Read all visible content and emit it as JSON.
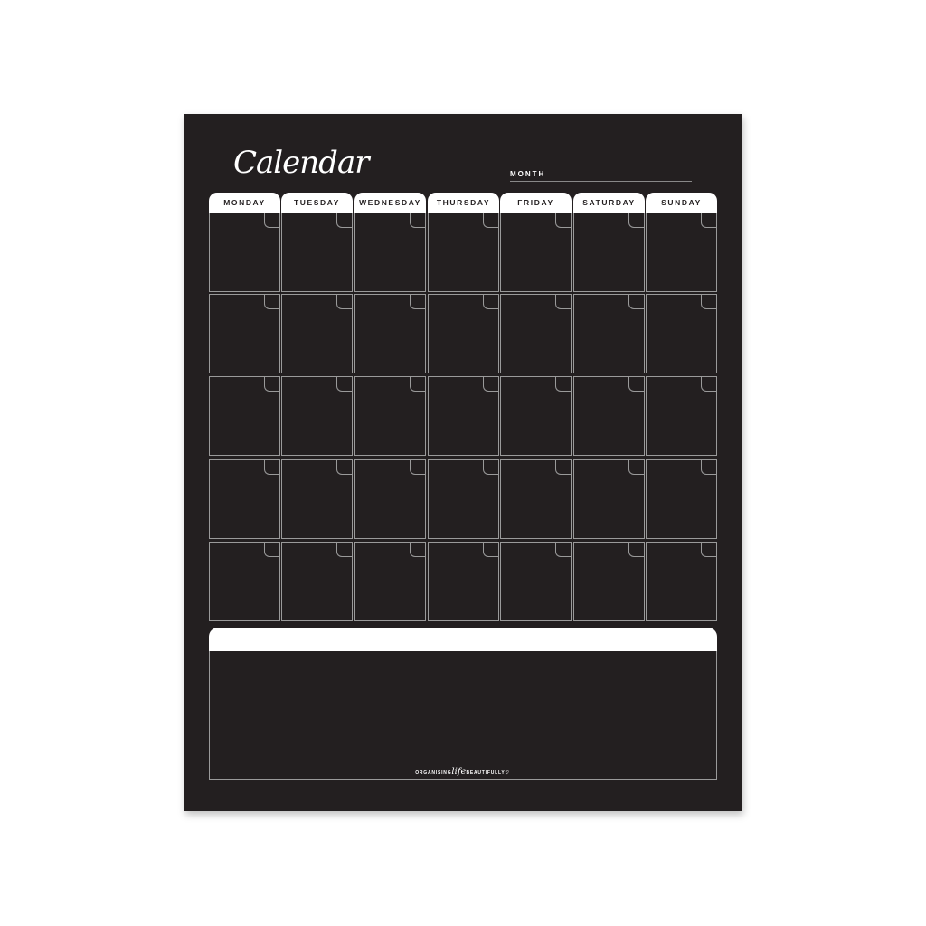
{
  "planner": {
    "title": "Calendar",
    "month_label": "MONTH",
    "month_value": "",
    "days": [
      "MONDAY",
      "TUESDAY",
      "WEDNESDAY",
      "THURSDAY",
      "FRIDAY",
      "SATURDAY",
      "SUNDAY"
    ],
    "weeks": 5,
    "notes_value": "",
    "brand": {
      "part1": "ORGANISING",
      "part2": "life",
      "part3": "BEAUTIFULLY",
      "heart": "♡"
    }
  },
  "colors": {
    "background": "#231f20",
    "accent": "#ffffff",
    "lines": "#9a9a9a"
  }
}
